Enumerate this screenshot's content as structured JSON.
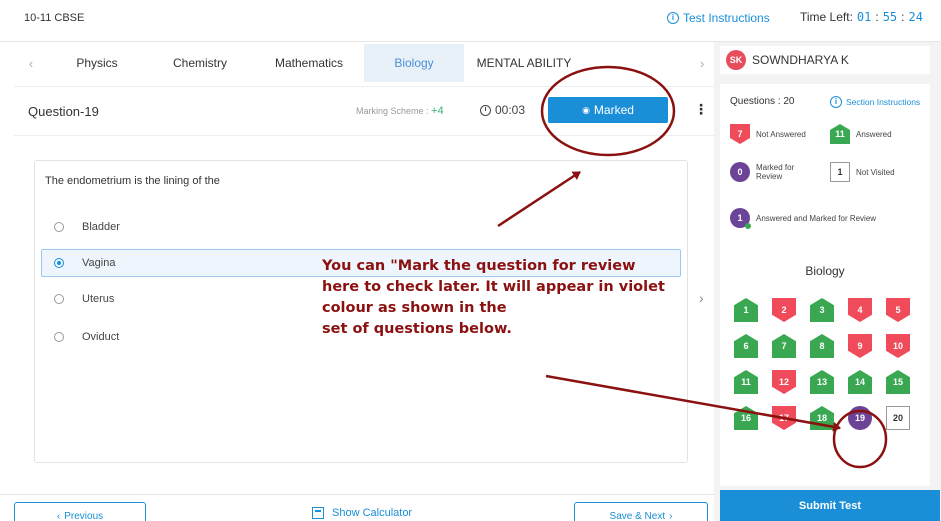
{
  "header": {
    "test_name": "10-11 CBSE",
    "instructions_label": "Test Instructions",
    "time_left_label": "Time Left:",
    "time_hh": "01",
    "time_mm": "55",
    "time_ss": "24"
  },
  "tabs": [
    {
      "label": "Physics",
      "active": false
    },
    {
      "label": "Chemistry",
      "active": false
    },
    {
      "label": "Mathematics",
      "active": false
    },
    {
      "label": "Biology",
      "active": true
    },
    {
      "label": "MENTAL ABILITY",
      "active": false
    }
  ],
  "question_header": {
    "number_label": "Question-19",
    "marking_label": "Marking Scheme :",
    "marking_value": "+4",
    "time_spent": "00:03",
    "marked_label": "Marked"
  },
  "question": {
    "text": "The endometrium is the lining of the",
    "options": [
      {
        "label": "Bladder",
        "selected": false
      },
      {
        "label": "Vagina",
        "selected": true
      },
      {
        "label": "Uterus",
        "selected": false
      },
      {
        "label": "Oviduct",
        "selected": false
      }
    ]
  },
  "annotation": {
    "lines": [
      "You can \"Mark the question for review",
      "here to check later. It will appear in violet",
      "colour as shown in the",
      "set of questions below."
    ],
    "color": "#8b1010"
  },
  "footer": {
    "previous_label": "Previous",
    "calculator_label": "Show Calculator",
    "save_next_label": "Save & Next"
  },
  "user": {
    "initials": "SK",
    "name": "SOWNDHARYA K"
  },
  "legend": {
    "questions_count": "Questions : 20",
    "section_instructions": "Section Instructions",
    "not_answered": {
      "count": "7",
      "label": "Not Answered"
    },
    "answered": {
      "count": "11",
      "label": "Answered"
    },
    "marked_for_review": {
      "count": "0",
      "label": "Marked for Review"
    },
    "not_visited": {
      "count": "1",
      "label": "Not Visited"
    },
    "answered_marked": {
      "count": "1",
      "label": "Answered and Marked for Review"
    }
  },
  "section": {
    "title": "Biology",
    "questions": [
      {
        "n": "1",
        "status": "answered"
      },
      {
        "n": "2",
        "status": "not_answered"
      },
      {
        "n": "3",
        "status": "answered"
      },
      {
        "n": "4",
        "status": "not_answered"
      },
      {
        "n": "5",
        "status": "not_answered"
      },
      {
        "n": "6",
        "status": "answered"
      },
      {
        "n": "7",
        "status": "answered"
      },
      {
        "n": "8",
        "status": "answered"
      },
      {
        "n": "9",
        "status": "not_answered"
      },
      {
        "n": "10",
        "status": "not_answered"
      },
      {
        "n": "11",
        "status": "answered"
      },
      {
        "n": "12",
        "status": "not_answered"
      },
      {
        "n": "13",
        "status": "answered"
      },
      {
        "n": "14",
        "status": "answered"
      },
      {
        "n": "15",
        "status": "answered"
      },
      {
        "n": "16",
        "status": "answered"
      },
      {
        "n": "17",
        "status": "not_answered"
      },
      {
        "n": "18",
        "status": "answered"
      },
      {
        "n": "19",
        "status": "answered_marked"
      },
      {
        "n": "20",
        "status": "not_visited"
      }
    ]
  },
  "submit_label": "Submit Test",
  "colors": {
    "accent": "#1a8fd8",
    "answered": "#3aa852",
    "not_answered": "#ef4b5a",
    "marked": "#6b4397",
    "annotation": "#8b1010"
  }
}
